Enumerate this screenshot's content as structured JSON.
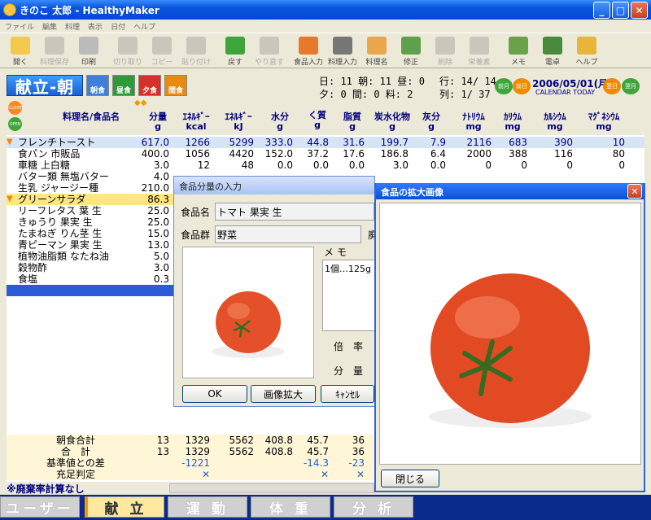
{
  "window": {
    "title": "きのこ 太郎 - HealthyMaker"
  },
  "menu": [
    "ファイル",
    "編集",
    "料理",
    "表示",
    "日付",
    "ヘルプ"
  ],
  "toolbar": [
    {
      "label": "開く",
      "enabled": true,
      "icon": "folder-icon"
    },
    {
      "label": "料理保存",
      "enabled": false,
      "icon": "save-icon"
    },
    {
      "label": "印刷",
      "enabled": true,
      "icon": "printer-icon"
    },
    {
      "label": "切り取り",
      "enabled": false,
      "icon": "scissors-icon"
    },
    {
      "label": "コピー",
      "enabled": false,
      "icon": "copy-icon"
    },
    {
      "label": "貼り付け",
      "enabled": false,
      "icon": "paste-icon"
    },
    {
      "label": "戻す",
      "enabled": true,
      "icon": "undo-icon"
    },
    {
      "label": "やり直す",
      "enabled": false,
      "icon": "redo-icon"
    },
    {
      "label": "食品入力",
      "enabled": true,
      "icon": "carrot-icon"
    },
    {
      "label": "料理入力",
      "enabled": true,
      "icon": "fork-knife-icon"
    },
    {
      "label": "料理名",
      "enabled": true,
      "icon": "cook-icon"
    },
    {
      "label": "修正",
      "enabled": true,
      "icon": "edit-icon"
    },
    {
      "label": "削除",
      "enabled": false,
      "icon": "trash-icon"
    },
    {
      "label": "栄養素",
      "enabled": false,
      "icon": "scale-icon"
    },
    {
      "label": "メモ",
      "enabled": true,
      "icon": "memo-icon"
    },
    {
      "label": "電卓",
      "enabled": true,
      "icon": "calculator-icon"
    },
    {
      "label": "ヘルプ",
      "enabled": true,
      "icon": "help-icon"
    }
  ],
  "header": {
    "mode_label": "献立-朝",
    "meal_buttons": [
      "朝食",
      "昼食",
      "夕食",
      "間食"
    ],
    "close_label": "CLOSE",
    "open_label": "OPEN",
    "counts_line1": "日: 11 朝: 11 昼:  0",
    "counts_line2": "夕:  0 間:  0 料:  2",
    "pos_line1": "行: 14/ 14",
    "pos_line2": "列:  1/ 37",
    "prev_month": "前月",
    "prev_day": "前日",
    "next_day": "翌日",
    "next_month": "翌月",
    "date": "2006/05/01(月)",
    "calendar_label": "CALENDAR",
    "today_label": "TODAY"
  },
  "columns": [
    {
      "name": "料理名/食品名",
      "unit": ""
    },
    {
      "name": "分量",
      "unit": "g"
    },
    {
      "name": "ｴﾈﾙｷﾞｰ",
      "unit": "kcal"
    },
    {
      "name": "ｴﾈﾙｷﾞｰ",
      "unit": "kJ"
    },
    {
      "name": "水分",
      "unit": "g"
    },
    {
      "name": "たんぱく質",
      "unit": "g"
    },
    {
      "name": "脂質",
      "unit": "g"
    },
    {
      "name": "炭水化物",
      "unit": "g"
    },
    {
      "name": "灰分",
      "unit": "g"
    },
    {
      "name": "ﾅﾄﾘｳﾑ",
      "unit": "mg"
    },
    {
      "name": "ｶﾘｳﾑ",
      "unit": "mg"
    },
    {
      "name": "ｶﾙｼｳﾑ",
      "unit": "mg"
    },
    {
      "name": "ﾏｸﾞﾈｼｳﾑ",
      "unit": "mg"
    }
  ],
  "rows": [
    {
      "type": "dish",
      "name": "フレンチトースト",
      "values": [
        "617.0",
        "1266",
        "5299",
        "333.0",
        "44.8",
        "31.6",
        "199.7",
        "7.9",
        "2116",
        "683",
        "390",
        "10"
      ]
    },
    {
      "type": "food",
      "name": "食パン 市販品",
      "values": [
        "400.0",
        "1056",
        "4420",
        "152.0",
        "37.2",
        "17.6",
        "186.8",
        "6.4",
        "2000",
        "388",
        "116",
        "80"
      ]
    },
    {
      "type": "food",
      "name": "車糖 上白糖",
      "values": [
        "3.0",
        "12",
        "48",
        "0.0",
        "0.0",
        "0.0",
        "3.0",
        "0.0",
        "0",
        "0",
        "0",
        "0"
      ]
    },
    {
      "type": "food",
      "name": "バター類 無塩バター",
      "values": [
        "4.0",
        "",
        "",
        "",
        "",
        "",
        "",
        "",
        "",
        "",
        "",
        ""
      ]
    },
    {
      "type": "food",
      "name": "生乳 ジャージー種",
      "values": [
        "210.0",
        "",
        "",
        "",
        "",
        "",
        "",
        "",
        "",
        "",
        "",
        ""
      ]
    },
    {
      "type": "dish",
      "name": "グリーンサラダ",
      "values": [
        "86.3",
        "",
        "",
        "",
        "",
        "",
        "",
        "",
        "",
        "",
        "",
        ""
      ]
    },
    {
      "type": "food",
      "name": "リーフレタス 葉 生",
      "values": [
        "25.0",
        "",
        "",
        "",
        "",
        "",
        "",
        "",
        "",
        "",
        "",
        ""
      ]
    },
    {
      "type": "food",
      "name": "きゅうり 果実 生",
      "values": [
        "25.0",
        "",
        "",
        "",
        "",
        "",
        "",
        "",
        "",
        "",
        "",
        ""
      ]
    },
    {
      "type": "food",
      "name": "たまねぎ りん茎 生",
      "values": [
        "15.0",
        "",
        "",
        "",
        "",
        "",
        "",
        "",
        "",
        "",
        "",
        ""
      ]
    },
    {
      "type": "food",
      "name": "青ピーマン 果実 生",
      "values": [
        "13.0",
        "",
        "",
        "",
        "",
        "",
        "",
        "",
        "",
        "",
        "",
        ""
      ]
    },
    {
      "type": "food",
      "name": "植物油脂類 なたね油",
      "values": [
        "5.0",
        "",
        "",
        "",
        "",
        "",
        "",
        "",
        "",
        "",
        "",
        ""
      ]
    },
    {
      "type": "food",
      "name": "穀物酢",
      "values": [
        "3.0",
        "",
        "",
        "",
        "",
        "",
        "",
        "",
        "",
        "",
        "",
        ""
      ]
    },
    {
      "type": "food",
      "name": "食塩",
      "values": [
        "0.3",
        "",
        "",
        "",
        "",
        "",
        "",
        "",
        "",
        "",
        "",
        ""
      ]
    }
  ],
  "totals": [
    {
      "label": "朝食合計",
      "values": [
        "13",
        "1329",
        "5562",
        "408.8",
        "45.7",
        "36"
      ]
    },
    {
      "label": "合　計",
      "values": [
        "13",
        "1329",
        "5562",
        "408.8",
        "45.7",
        "36"
      ]
    },
    {
      "label": "基準値との差",
      "values": [
        "",
        "-1221",
        "",
        "",
        "-14.3",
        "-23"
      ]
    },
    {
      "label": "充足判定",
      "values": [
        "",
        "✕",
        "",
        "",
        "✕",
        "✕"
      ]
    }
  ],
  "note": "※廃棄率計算なし",
  "tabs": [
    "ユーザー",
    "献 立",
    "運 動",
    "体 重",
    "分 析"
  ],
  "dialog": {
    "title": "食品分量の入力",
    "food_name_label": "食品名",
    "food_name": "トマト 果実 生",
    "group_label": "食品群",
    "group": "野菜",
    "trailing_label": "廃",
    "memo_label": "メ モ",
    "memo": "1個…125g",
    "ratio_label": "倍　率",
    "amount_label": "分　量",
    "ok": "OK",
    "zoom": "画像拡大",
    "cancel": "ｷｬﾝｾﾙ"
  },
  "zoom_window": {
    "title": "食品の拡大画像",
    "close_button": "閉じる"
  }
}
